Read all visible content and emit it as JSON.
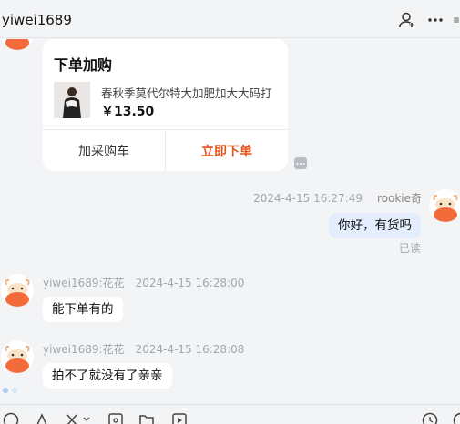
{
  "header": {
    "title": "yiwei1689",
    "icons": [
      "add-person-icon",
      "more-icon",
      "menu-icon"
    ]
  },
  "order_card": {
    "title": "下单加购",
    "product_name": "春秋季莫代尔特大加肥加大大码打",
    "price": "￥13.50",
    "add_to_cart_label": "加采购车",
    "buy_now_label": "立即下单"
  },
  "messages": [
    {
      "side": "right",
      "sender": "rookie奇",
      "timestamp": "2024-4-15 16:27:49",
      "text": "你好，有货吗",
      "status": "已读"
    },
    {
      "side": "left",
      "sender": "yiwei1689:花花",
      "timestamp": "2024-4-15 16:28:00",
      "text": "能下单有的"
    },
    {
      "side": "left",
      "sender": "yiwei1689:花花",
      "timestamp": "2024-4-15 16:28:08",
      "text": "拍不了就没有了亲亲"
    }
  ],
  "toolbar": {
    "icons": [
      "emoji-icon",
      "font-icon",
      "scissors-icon",
      "image-icon",
      "folder-icon",
      "video-icon",
      "history-icon",
      "chevron-icon"
    ]
  },
  "colors": {
    "accent": "#e8531b",
    "bubble_self": "#e3edfd",
    "background": "#f3f4f6",
    "mascot_orange": "#f36b3b"
  }
}
